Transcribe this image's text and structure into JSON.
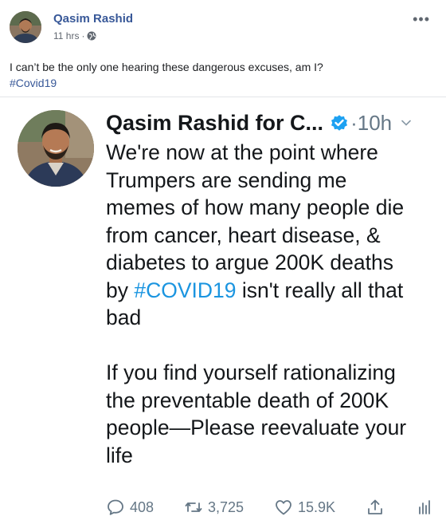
{
  "post": {
    "author": "Qasim Rashid",
    "time": "11 hrs",
    "separator": "·",
    "text": "I can’t be the only one hearing these dangerous excuses, am I?",
    "hashtag": "#Covid19",
    "more": "•••"
  },
  "tweet": {
    "display_name": "Qasim Rashid for C...",
    "separator": "·",
    "time": "10h",
    "paragraph1_line1": "We're now at the point where",
    "paragraph1_line2": "Trumpers are sending me",
    "paragraph1_line3": "memes of how many people die",
    "paragraph1_line4": "from cancer, heart disease, &",
    "paragraph1_line5": "diabetes to argue 200K deaths",
    "paragraph1_line6_before": "by ",
    "paragraph1_hashtag": "#COVID19",
    "paragraph1_line6_after": " isn't really all that",
    "paragraph1_line7": "bad",
    "paragraph2_line1": "If you find yourself rationalizing",
    "paragraph2_line2": "the preventable death of 200K",
    "paragraph2_line3": "people—Please reevaluate your",
    "paragraph2_line4": "life",
    "replies": "408",
    "retweets": "3,725",
    "likes": "15.9K"
  },
  "icons": {
    "globe": "globe-icon",
    "more": "more-options-icon",
    "verified": "verified-badge-icon",
    "chevron": "chevron-down-icon",
    "reply": "reply-icon",
    "retweet": "retweet-icon",
    "like": "heart-icon",
    "share": "share-icon",
    "analytics": "analytics-icon"
  },
  "colors": {
    "fb_link": "#385898",
    "twitter_blue": "#1b95e0",
    "twitter_gray": "#657786",
    "text": "#14171a"
  }
}
